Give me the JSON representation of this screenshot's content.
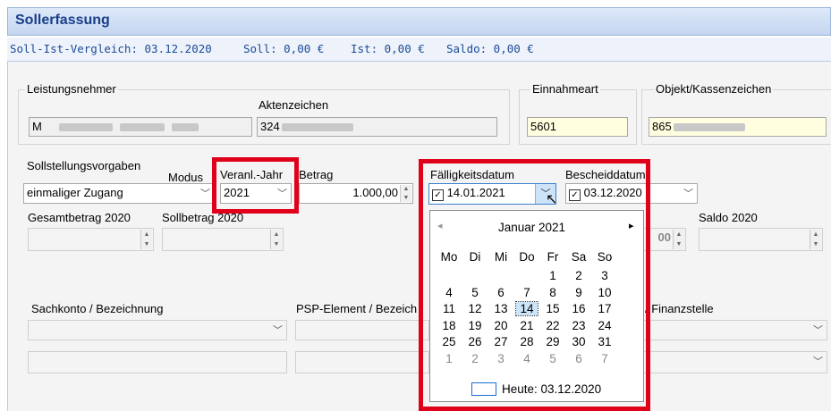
{
  "title": "Sollerfassung",
  "info_bar": {
    "vergleich": "Soll-Ist-Vergleich: 03.12.2020",
    "soll": "Soll: 0,00 €",
    "ist": "Ist: 0,00 €",
    "saldo": "Saldo: 0,00 €"
  },
  "leistungsnehmer": {
    "legend": "Leistungsnehmer",
    "name_value": "M",
    "aktenzeichen_label": "Aktenzeichen",
    "aktenzeichen_value": "324"
  },
  "einnahmeart": {
    "legend": "Einnahmeart",
    "value": "5601"
  },
  "objekt": {
    "legend": "Objekt/Kassenzeichen",
    "value": "865"
  },
  "sollstellung": {
    "legend": "Sollstellungsvorgaben",
    "modus_label": "Modus",
    "modus_value": "einmaliger Zugang",
    "jahr_label": "Veranl.-Jahr",
    "jahr_value": "2021",
    "betrag_label": "Betrag",
    "betrag_value": "1.000,00",
    "faellig_label": "Fälligkeitsdatum",
    "faellig_value": "14.01.2021",
    "bescheid_label": "Bescheiddatum",
    "bescheid_value": "03.12.2020",
    "gesamt_label": "Gesamtbetrag 2020",
    "sollbetrag_label": "Sollbetrag 2020",
    "saldo_label": "Saldo 2020",
    "partial_value": "00"
  },
  "accounts": {
    "sachkonto_label": "Sachkonto / Bezeichnung",
    "psp_label": "PSP-Element / Bezeich",
    "finanz_label": "/ Finanzstelle"
  },
  "calendar": {
    "month": "Januar 2021",
    "prev": "◂",
    "next": "▸",
    "weekdays": [
      "Mo",
      "Di",
      "Mi",
      "Do",
      "Fr",
      "Sa",
      "So"
    ],
    "weeks": [
      [
        "",
        "",
        "",
        "",
        "1",
        "2",
        "3"
      ],
      [
        "4",
        "5",
        "6",
        "7",
        "8",
        "9",
        "10"
      ],
      [
        "11",
        "12",
        "13",
        "14",
        "15",
        "16",
        "17"
      ],
      [
        "18",
        "19",
        "20",
        "21",
        "22",
        "23",
        "24"
      ],
      [
        "25",
        "26",
        "27",
        "28",
        "29",
        "30",
        "31"
      ],
      [
        "1",
        "2",
        "3",
        "4",
        "5",
        "6",
        "7"
      ]
    ],
    "selected": "14",
    "today_label": "Heute: 03.12.2020"
  },
  "colors": {
    "accent": "#1a4a96",
    "highlight": "#e0001a",
    "title_bg": "#c9daf3"
  }
}
